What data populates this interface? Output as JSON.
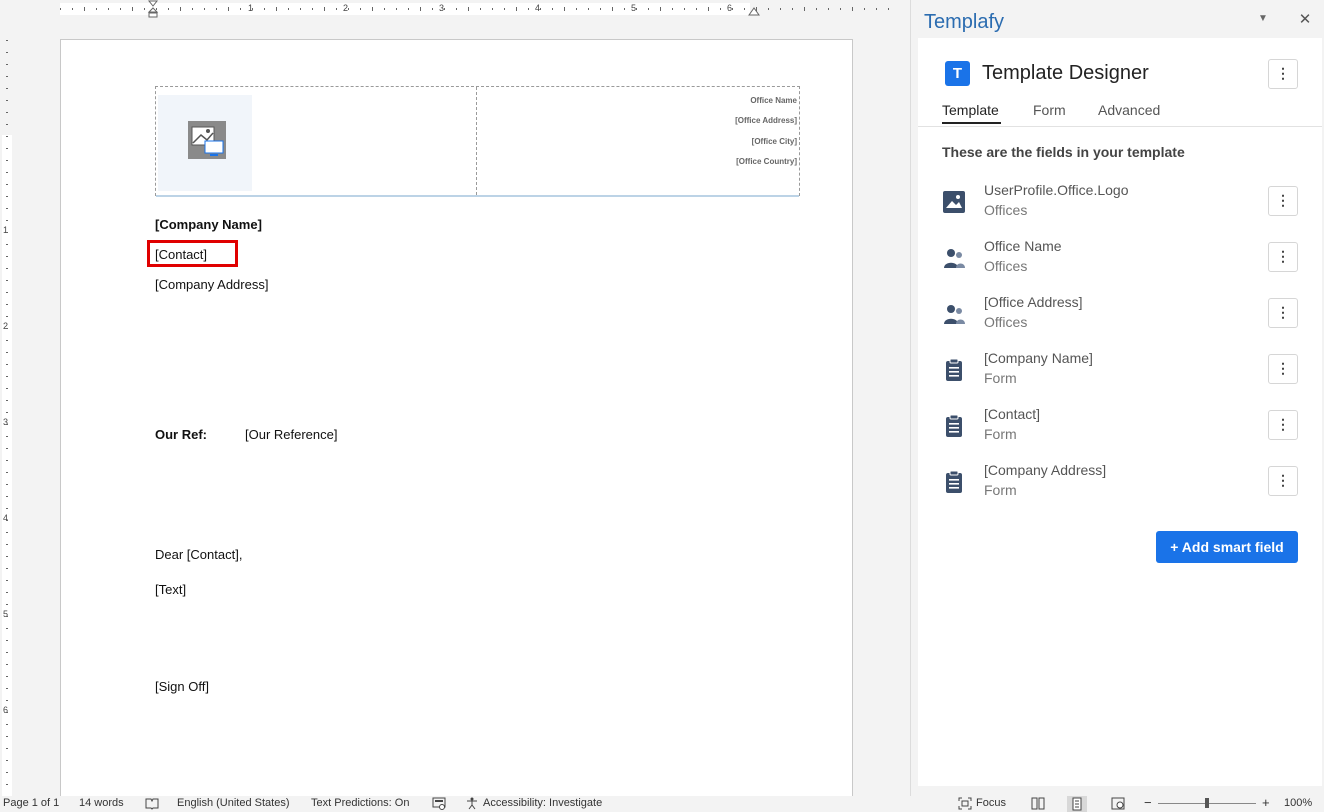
{
  "document": {
    "header": {
      "office_lines": [
        "Office Name",
        "[Office Address]",
        "[Office City]",
        "[Office Country]"
      ]
    },
    "company_name": "[Company Name]",
    "contact": "[Contact]",
    "company_address": "[Company Address]",
    "our_ref_label": "Our Ref:",
    "our_ref_value": "[Our Reference]",
    "greeting": "Dear [Contact],",
    "text": "[Text]",
    "sign_off": "[Sign Off]"
  },
  "ruler": {
    "horizontal_numbers": [
      "1",
      "2",
      "3",
      "4",
      "5",
      "6"
    ],
    "vertical_numbers": [
      "1",
      "2",
      "3",
      "4",
      "5",
      "6"
    ]
  },
  "panel": {
    "app_title": "Templafy",
    "menu_icon": "caret-down-icon",
    "close_icon": "close-icon",
    "title": "Template Designer",
    "logo_letter": "T",
    "tabs": [
      {
        "label": "Template",
        "active": true
      },
      {
        "label": "Form",
        "active": false
      },
      {
        "label": "Advanced",
        "active": false
      }
    ],
    "fields_heading": "These are the fields in your template",
    "fields": [
      {
        "name": "UserProfile.Office.Logo",
        "source": "Offices",
        "icon": "image-icon"
      },
      {
        "name": "Office Name",
        "source": "Offices",
        "icon": "people-icon"
      },
      {
        "name": "[Office Address]",
        "source": "Offices",
        "icon": "people-icon"
      },
      {
        "name": "[Company Name]",
        "source": "Form",
        "icon": "clipboard-icon"
      },
      {
        "name": "[Contact]",
        "source": "Form",
        "icon": "clipboard-icon"
      },
      {
        "name": "[Company Address]",
        "source": "Form",
        "icon": "clipboard-icon"
      }
    ],
    "add_button": "+ Add smart field",
    "colors": {
      "accent": "#1a73e8",
      "title": "#2b6cb0",
      "highlight": "#e00000"
    }
  },
  "status_bar": {
    "page": "Page 1 of 1",
    "words": "14 words",
    "language": "English (United States)",
    "text_predictions": "Text Predictions: On",
    "accessibility": "Accessibility: Investigate",
    "focus": "Focus",
    "zoom_minus": "−",
    "zoom_plus": "+",
    "zoom": "100%"
  }
}
